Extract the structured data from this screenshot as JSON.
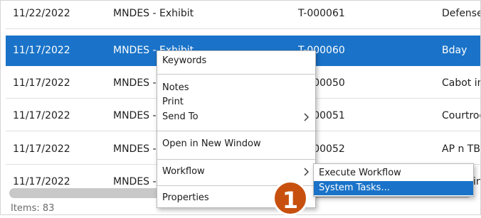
{
  "table": {
    "rows": [
      {
        "date": "11/22/2022",
        "name": "MNDES - Exhibit",
        "id": "T-000061",
        "extra": "Defense -"
      },
      {
        "date": "11/17/2022",
        "name": "MNDES - Exhibit",
        "id": "T-000060",
        "extra": "Bday"
      },
      {
        "date": "11/17/2022",
        "name": "MNDES - E",
        "id": "T-000050",
        "extra": "Cabot in"
      },
      {
        "date": "11/17/2022",
        "name": "MNDES - E",
        "id": "T-000051",
        "extra": "Courtroo"
      },
      {
        "date": "11/17/2022",
        "name": "MNDES - E",
        "id": "T-000052",
        "extra": "AP n TB"
      },
      {
        "date": "11/17/2022",
        "name": "MNDES - E",
        "id": "",
        "extra": "Fin"
      }
    ],
    "selected_index": 1
  },
  "status": {
    "items_label": "Items: 83"
  },
  "context_menu": {
    "keywords": "Keywords",
    "notes": "Notes",
    "print": "Print",
    "send_to": "Send To",
    "open_new_window": "Open in New Window",
    "workflow": "Workflow",
    "properties": "Properties"
  },
  "workflow_submenu": {
    "execute_workflow": "Execute Workflow",
    "system_tasks": "System Tasks..."
  },
  "callout": {
    "number": "1",
    "color": "#c8500e"
  },
  "colors": {
    "selection": "#1a73c8"
  }
}
